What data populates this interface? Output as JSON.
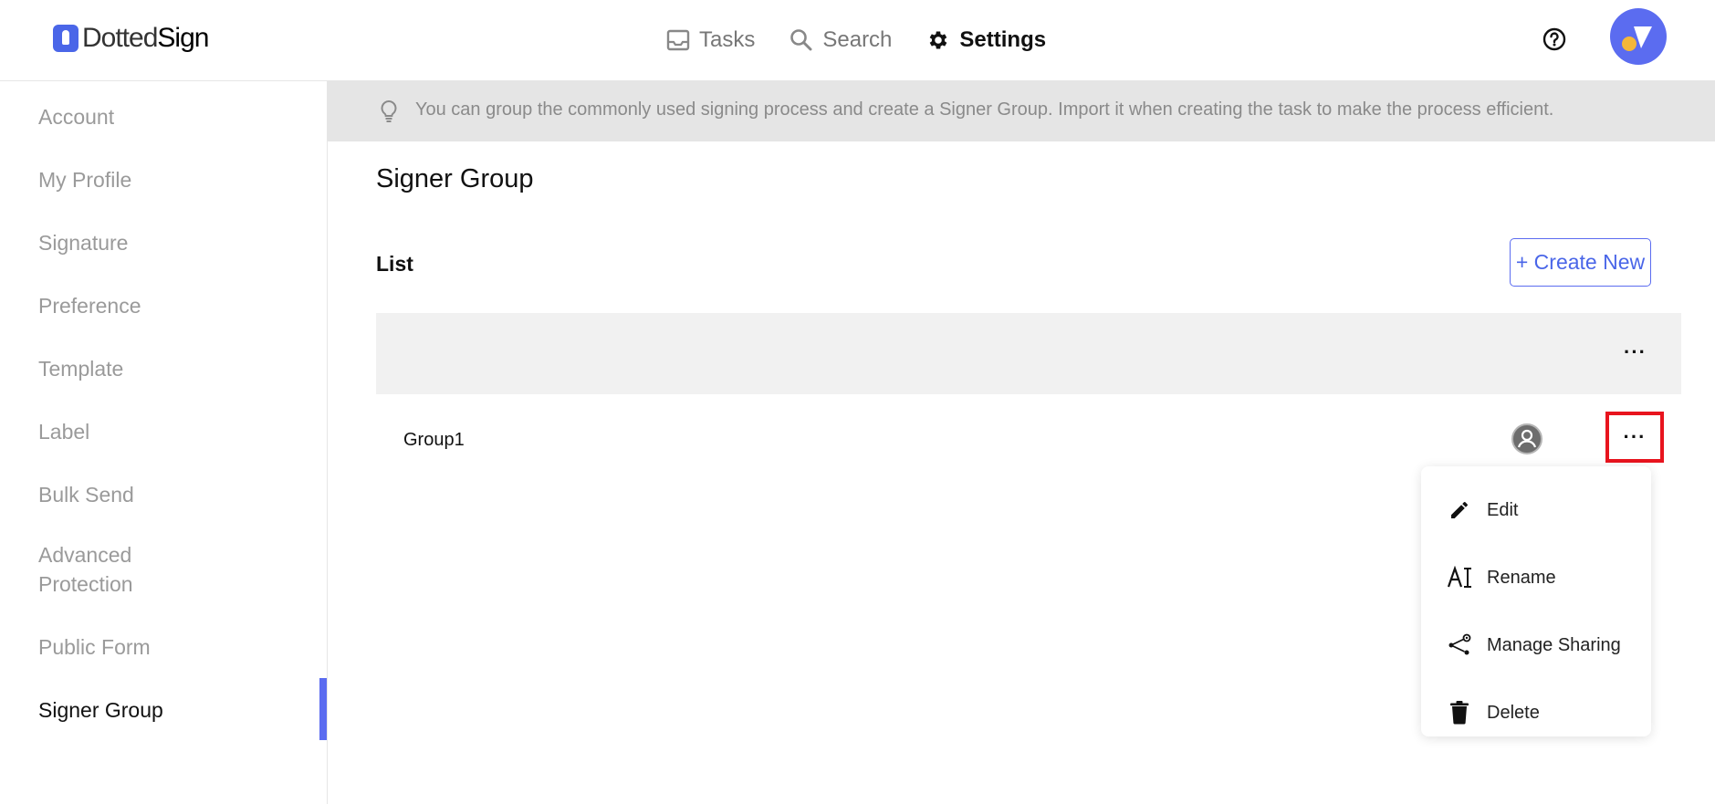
{
  "app": {
    "logo_light": "Dotted",
    "logo_bold": "Sign"
  },
  "nav": {
    "tasks": "Tasks",
    "search": "Search",
    "settings": "Settings"
  },
  "sidebar": {
    "items": [
      {
        "label": "Account"
      },
      {
        "label": "My Profile"
      },
      {
        "label": "Signature"
      },
      {
        "label": "Preference"
      },
      {
        "label": "Template"
      },
      {
        "label": "Label"
      },
      {
        "label": "Bulk Send"
      },
      {
        "label": "Advanced Protection"
      },
      {
        "label": "Public Form"
      },
      {
        "label": "Signer Group"
      }
    ],
    "active": "Signer Group"
  },
  "tip": {
    "text": "You can group the commonly used signing process and create a Signer Group. Import it when creating the task to make the process efficient."
  },
  "main": {
    "title": "Signer Group",
    "list_label": "List",
    "create_button": "+ Create New",
    "more_glyph": "···",
    "rows": [
      {
        "name": "Group1"
      }
    ]
  },
  "menu": {
    "items": [
      {
        "label": "Edit",
        "icon": "pencil-icon"
      },
      {
        "label": "Rename",
        "icon": "rename-text-icon"
      },
      {
        "label": "Manage Sharing",
        "icon": "share-icon"
      },
      {
        "label": "Delete",
        "icon": "trash-icon"
      }
    ]
  },
  "colors": {
    "accent": "#5b6cf0",
    "highlight_border": "#e8141e",
    "tip_background": "#e5e5e5",
    "table_head_background": "#f1f1f1"
  }
}
